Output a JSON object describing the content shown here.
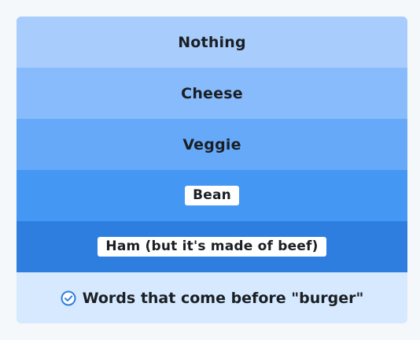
{
  "options": [
    {
      "label": "Nothing",
      "style": "plain",
      "color": "#a8cdfd"
    },
    {
      "label": "Cheese",
      "style": "plain",
      "color": "#87bbfb"
    },
    {
      "label": "Veggie",
      "style": "plain",
      "color": "#66a9f8"
    },
    {
      "label": "Bean",
      "style": "chip",
      "color": "#4597f4"
    },
    {
      "label": "Ham (but it's made of beef)",
      "style": "chip",
      "color": "#2e7ee0"
    }
  ],
  "footer": {
    "icon": "check-circle-icon",
    "text": "Words that come before \"burger\"",
    "color": "#d6e9ff"
  },
  "accent": "#2e7ee0"
}
